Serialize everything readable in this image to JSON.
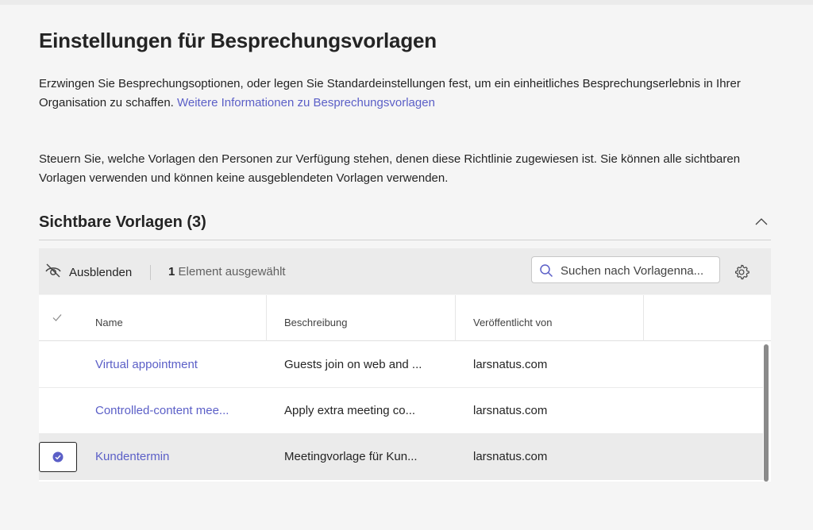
{
  "page": {
    "title": "Einstellungen für Besprechungsvorlagen",
    "intro": "Erzwingen Sie Besprechungsoptionen, oder legen Sie Standardeinstellungen fest, um ein einheitliches Besprechungserlebnis in Ihrer Organisation zu schaffen.",
    "intro_link": "Weitere Informationen zu Besprechungsvorlagen",
    "description": "Steuern Sie, welche Vorlagen den Personen zur Verfügung stehen, denen diese Richtlinie zugewiesen ist. Sie können alle sichtbaren Vorlagen verwenden und können keine ausgeblendeten Vorlagen verwenden."
  },
  "section": {
    "title": "Sichtbare Vorlagen (3)",
    "collapse_icon": "chevron-up-icon"
  },
  "toolbar": {
    "hide_label": "Ausblenden",
    "hide_icon": "eye-off-icon",
    "selected_count": "1",
    "selected_text": "Element ausgewählt",
    "search_placeholder": "Suchen nach Vorlagenna...",
    "search_icon": "search-icon",
    "settings_icon": "gear-icon"
  },
  "table": {
    "columns": [
      "Name",
      "Beschreibung",
      "Veröffentlicht von"
    ],
    "rows": [
      {
        "name": "Virtual appointment",
        "description": "Guests join on web and ...",
        "publisher": "larsnatus.com",
        "selected": false
      },
      {
        "name": "Controlled-content mee...",
        "description": "Apply extra meeting co...",
        "publisher": "larsnatus.com",
        "selected": false
      },
      {
        "name": "Kundentermin",
        "description": "Meetingvorlage für Kun...",
        "publisher": "larsnatus.com",
        "selected": true
      }
    ]
  },
  "colors": {
    "accent": "#5b5fc7",
    "text": "#242424",
    "background": "#f5f5f5",
    "toolbar": "#ebebeb"
  }
}
